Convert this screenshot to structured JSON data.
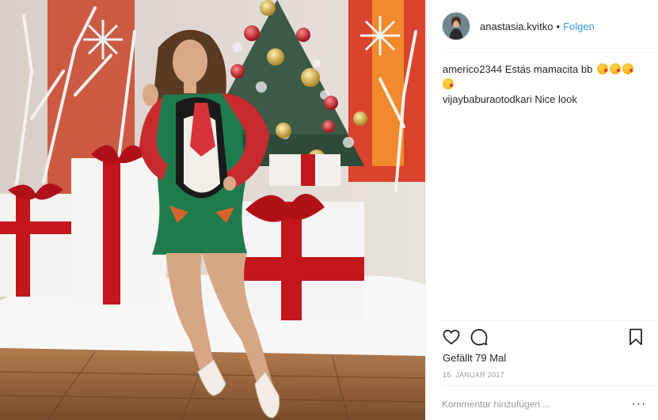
{
  "post": {
    "author": {
      "username": "anastasia.kvitko",
      "separator": "•",
      "follow_label": "Folgen"
    },
    "comments": [
      {
        "username": "americo2344",
        "text": "Estás mamacita bb",
        "emoji": [
          "face-blowing-kiss",
          "face-blowing-kiss",
          "face-blowing-kiss",
          "face-blowing-kiss"
        ]
      },
      {
        "username": "vijaybaburaotodkari",
        "text": "Nice look",
        "emoji": []
      }
    ],
    "likes_text": "Gefällt 79 Mal",
    "date_text": "15. JANUAR 2017",
    "comment_input": {
      "placeholder": "Kommentar hinzufügen ...",
      "value": ""
    },
    "more_label": "···",
    "icons": {
      "like": "heart-icon",
      "comment": "comment-bubble-icon",
      "save": "bookmark-icon",
      "more": "more-options-icon"
    },
    "colors": {
      "link": "#3897f0",
      "text": "#262626",
      "muted": "#999999",
      "divider": "#efefef"
    }
  }
}
